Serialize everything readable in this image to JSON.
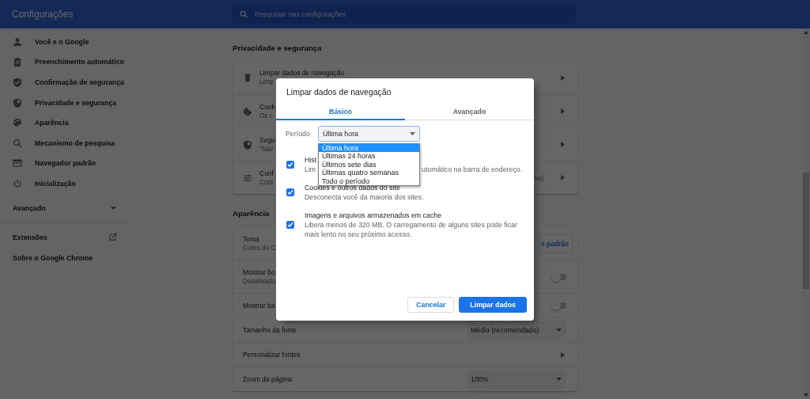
{
  "header": {
    "title": "Configurações",
    "search": {
      "placeholder": "Pesquisar nas configurações"
    }
  },
  "sidebar": {
    "items": [
      {
        "label": "Você e o Google"
      },
      {
        "label": "Preenchimento automático"
      },
      {
        "label": "Confirmação de segurança"
      },
      {
        "label": "Privacidade e segurança"
      },
      {
        "label": "Aparência"
      },
      {
        "label": "Mecanismo de pesquisa"
      },
      {
        "label": "Navegador padrão"
      },
      {
        "label": "Inicialização"
      }
    ],
    "advanced": {
      "label": "Avançado",
      "expanded": false
    },
    "links": [
      {
        "label": "Extensões",
        "kind": "external"
      },
      {
        "label": "Sobre o Google Chrome",
        "kind": "plain"
      }
    ]
  },
  "privacy": {
    "title": "Privacidade e segurança",
    "rows": [
      {
        "title": "Limpar dados de navegação",
        "subtitle": "Limp"
      },
      {
        "title": "Cook",
        "subtitle": "Os c"
      },
      {
        "title": "Segu",
        "subtitle": "\"Nav"
      },
      {
        "title": "Conf",
        "subtitle": "Cont",
        "trailing": "os)"
      }
    ]
  },
  "appearance": {
    "title": "Aparência",
    "rows": [
      {
        "kind": "button",
        "title": "Tema",
        "subtitle": "Cores do C",
        "button": "s padrão"
      },
      {
        "kind": "toggle",
        "title": "Mostrar bo",
        "subtitle": "Desativado",
        "on": false
      },
      {
        "kind": "toggle",
        "title": "Mostrar ba",
        "on": false
      },
      {
        "kind": "select",
        "title": "Tamanho da fonte",
        "value": "Médio (recomendado)"
      },
      {
        "kind": "link",
        "title": "Personalizar fontes"
      },
      {
        "kind": "select",
        "title": "Zoom da página:",
        "value": "100%"
      }
    ]
  },
  "dialog": {
    "title": "Limpar dados de navegação",
    "tabs": [
      {
        "label": "Básico",
        "selected": true
      },
      {
        "label": "Avançado",
        "selected": false
      }
    ],
    "period": {
      "label": "Período",
      "value": "Última hora",
      "options": [
        {
          "label": "Última hora",
          "selected": true
        },
        {
          "label": "Últimas 24 horas",
          "selected": false
        },
        {
          "label": "Últimos sete dias",
          "selected": false
        },
        {
          "label": "Últimas quatro semanas",
          "selected": false
        },
        {
          "label": "Todo o período",
          "selected": false
        }
      ]
    },
    "items": [
      {
        "title": "Hist",
        "description": [
          "Lim",
          "utomático na barra de endereço."
        ],
        "checked": true
      },
      {
        "title": "Cookies e outros dados do site",
        "description": [
          "Desconecta você da maioria dos sites."
        ],
        "checked": true
      },
      {
        "title": "Imagens e arquivos armazenados em cache",
        "description": [
          "Libera menos de 320 MB. O carregamento de alguns sites pode ficar mais lento no seu próximo acesso."
        ],
        "checked": true
      }
    ],
    "buttons": [
      {
        "label": "Cancelar",
        "kind": "secondary"
      },
      {
        "label": "Limpar dados",
        "kind": "primary"
      }
    ]
  }
}
